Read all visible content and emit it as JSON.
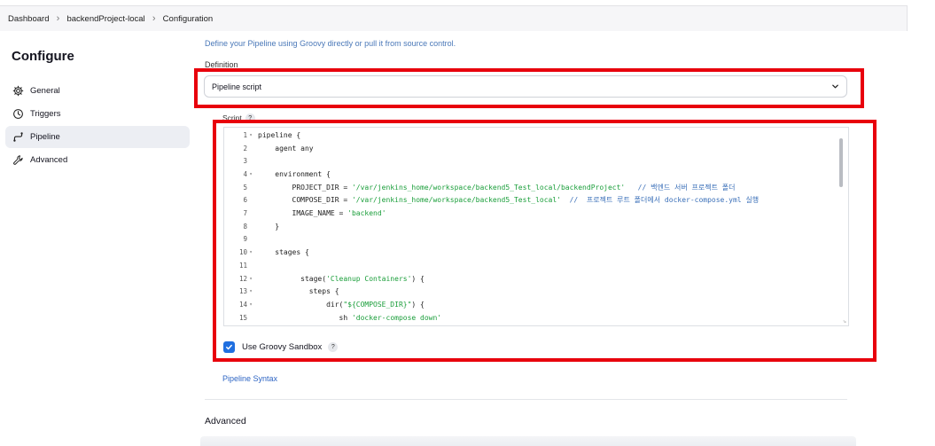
{
  "breadcrumb": {
    "items": [
      "Dashboard",
      "backendProject-local",
      "Configuration"
    ],
    "separator_icon": "chevron-right-icon"
  },
  "sidebar": {
    "title": "Configure",
    "items": [
      {
        "label": "General",
        "icon": "gear-icon",
        "active": false
      },
      {
        "label": "Triggers",
        "icon": "clock-icon",
        "active": false
      },
      {
        "label": "Pipeline",
        "icon": "pipeline-icon",
        "active": true
      },
      {
        "label": "Advanced",
        "icon": "wrench-icon",
        "active": false
      }
    ]
  },
  "pipeline": {
    "description": "Define your Pipeline using Groovy directly or pull it from source control.",
    "definition_label": "Definition",
    "definition_value": "Pipeline script",
    "script_label": "Script",
    "help_mark": "?",
    "code_lines": [
      {
        "n": "1",
        "fold": true,
        "parts": [
          {
            "t": "pipeline {",
            "c": "code"
          }
        ]
      },
      {
        "n": "2",
        "fold": false,
        "parts": [
          {
            "t": "    agent any",
            "c": "code"
          }
        ]
      },
      {
        "n": "3",
        "fold": false,
        "parts": [
          {
            "t": "",
            "c": "code"
          }
        ]
      },
      {
        "n": "4",
        "fold": true,
        "parts": [
          {
            "t": "    environment {",
            "c": "code"
          }
        ]
      },
      {
        "n": "5",
        "fold": false,
        "parts": [
          {
            "t": "        PROJECT_DIR = ",
            "c": "code"
          },
          {
            "t": "'/var/jenkins_home/workspace/backend5_Test_local/backendProject'",
            "c": "str"
          },
          {
            "t": "   // 백엔드 서버 프로젝트 폴더",
            "c": "cmt"
          }
        ]
      },
      {
        "n": "6",
        "fold": false,
        "parts": [
          {
            "t": "        COMPOSE_DIR = ",
            "c": "code"
          },
          {
            "t": "'/var/jenkins_home/workspace/backend5_Test_local'",
            "c": "str"
          },
          {
            "t": "  //  프로젝트 루트 폴더에서 docker-compose.yml 실행",
            "c": "cmt"
          }
        ]
      },
      {
        "n": "7",
        "fold": false,
        "parts": [
          {
            "t": "        IMAGE_NAME = ",
            "c": "code"
          },
          {
            "t": "'backend'",
            "c": "str"
          }
        ]
      },
      {
        "n": "8",
        "fold": false,
        "parts": [
          {
            "t": "    }",
            "c": "code"
          }
        ]
      },
      {
        "n": "9",
        "fold": false,
        "parts": [
          {
            "t": "",
            "c": "code"
          }
        ]
      },
      {
        "n": "10",
        "fold": true,
        "parts": [
          {
            "t": "    stages {",
            "c": "code"
          }
        ]
      },
      {
        "n": "11",
        "fold": false,
        "parts": [
          {
            "t": "",
            "c": "code"
          }
        ]
      },
      {
        "n": "12",
        "fold": true,
        "parts": [
          {
            "t": "          stage(",
            "c": "code"
          },
          {
            "t": "'Cleanup Containers'",
            "c": "str"
          },
          {
            "t": ") {",
            "c": "code"
          }
        ]
      },
      {
        "n": "13",
        "fold": true,
        "parts": [
          {
            "t": "            steps {",
            "c": "code"
          }
        ]
      },
      {
        "n": "14",
        "fold": true,
        "parts": [
          {
            "t": "                dir(",
            "c": "code"
          },
          {
            "t": "\"${COMPOSE_DIR}\"",
            "c": "str"
          },
          {
            "t": ") {",
            "c": "code"
          }
        ]
      },
      {
        "n": "15",
        "fold": false,
        "parts": [
          {
            "t": "                   sh ",
            "c": "code"
          },
          {
            "t": "'docker-compose down'",
            "c": "str"
          }
        ]
      }
    ],
    "sandbox_label": "Use Groovy Sandbox",
    "sandbox_checked": true,
    "syntax_link": "Pipeline Syntax"
  },
  "advanced_heading": "Advanced",
  "colors": {
    "highlight": "#e8000c",
    "accent": "#1f6fe0",
    "link": "#2f66c4",
    "string": "#1a9e3a",
    "comment": "#3a6fb8"
  }
}
